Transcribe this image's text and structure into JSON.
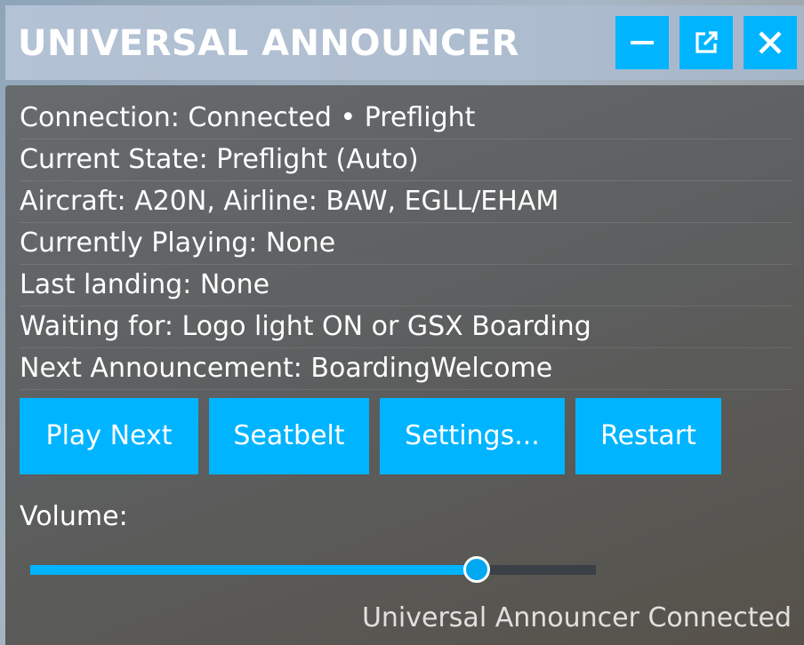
{
  "window": {
    "title": "UNIVERSAL ANNOUNCER",
    "controls": {
      "minimize_icon": "minimize-icon",
      "popout_icon": "external-window-icon",
      "close_icon": "close-icon"
    }
  },
  "info": {
    "rows": [
      "Connection: Connected • Preflight",
      "Current State: Preflight (Auto)",
      "Aircraft: A20N, Airline: BAW, EGLL/EHAM",
      "Currently Playing: None",
      "Last landing: None",
      "Waiting for: Logo light ON or GSX Boarding",
      "Next Announcement: BoardingWelcome"
    ]
  },
  "actions": {
    "play_next": "Play Next",
    "seatbelt": "Seatbelt",
    "settings": "Settings...",
    "restart": "Restart"
  },
  "volume": {
    "label": "Volume:",
    "level": 0.79
  },
  "status": {
    "text": "Universal Announcer Connected"
  },
  "colors": {
    "accent": "#00b4ff",
    "track": "#3b4046",
    "text": "#ffffff"
  }
}
